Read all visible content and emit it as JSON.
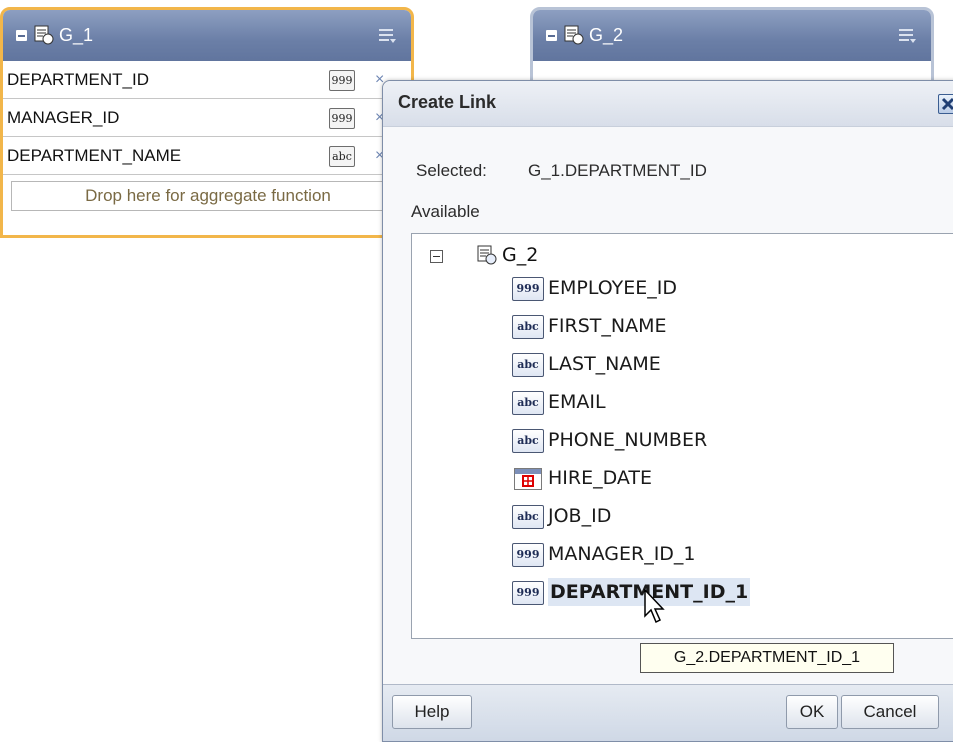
{
  "groups": [
    {
      "title": "G_1",
      "fields": [
        {
          "name": "DEPARTMENT_ID",
          "type": "999"
        },
        {
          "name": "MANAGER_ID",
          "type": "999"
        },
        {
          "name": "DEPARTMENT_NAME",
          "type": "abc"
        }
      ],
      "drop_hint": "Drop here for aggregate function"
    },
    {
      "title": "G_2"
    }
  ],
  "dialog": {
    "title": "Create Link",
    "selected_label": "Selected:",
    "selected_value": "G_1.DEPARTMENT_ID",
    "available_label": "Available",
    "tree_root": "G_2",
    "items": [
      {
        "name": "EMPLOYEE_ID",
        "type": "999"
      },
      {
        "name": "FIRST_NAME",
        "type": "abc"
      },
      {
        "name": "LAST_NAME",
        "type": "abc"
      },
      {
        "name": "EMAIL",
        "type": "abc"
      },
      {
        "name": "PHONE_NUMBER",
        "type": "abc"
      },
      {
        "name": "HIRE_DATE",
        "type": "date"
      },
      {
        "name": "JOB_ID",
        "type": "abc"
      },
      {
        "name": "MANAGER_ID_1",
        "type": "999"
      },
      {
        "name": "DEPARTMENT_ID_1",
        "type": "999"
      }
    ],
    "tooltip": "G_2.DEPARTMENT_ID_1",
    "help_label": "Help",
    "ok_label": "OK",
    "cancel_label": "Cancel"
  },
  "colors": {
    "accent_orange": "#f2b64a",
    "header_blue": "#6b7fa7"
  }
}
